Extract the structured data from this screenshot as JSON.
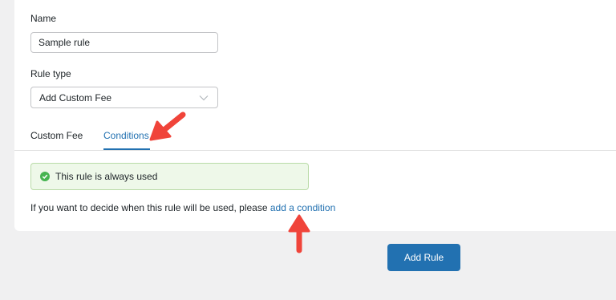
{
  "form": {
    "name_label": "Name",
    "name_value": "Sample rule",
    "rule_type_label": "Rule type",
    "rule_type_value": "Add Custom Fee"
  },
  "tabs": [
    {
      "label": "Custom Fee",
      "active": false
    },
    {
      "label": "Conditions",
      "active": true
    }
  ],
  "notice": {
    "text": "This rule is always used",
    "icon": "check-circle-icon",
    "color": "#46b450"
  },
  "help": {
    "text": "If you want to decide when this rule will be used, please",
    "link_text": "add a condition"
  },
  "actions": {
    "add_rule_label": "Add Rule"
  },
  "colors": {
    "accent": "#2271b1",
    "annotation_arrow": "#f0443a"
  }
}
